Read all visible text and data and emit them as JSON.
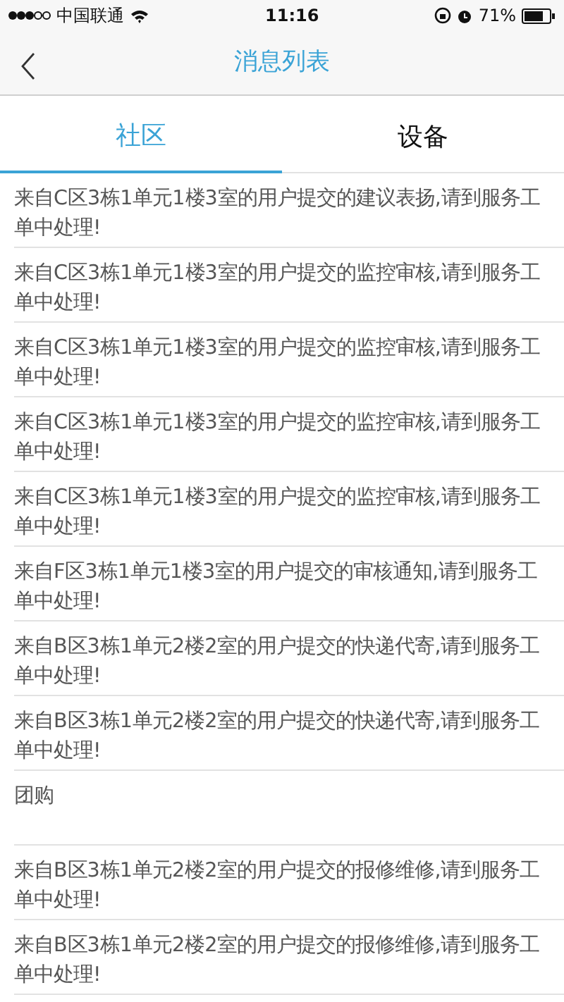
{
  "status_bar": {
    "carrier": "中国联通",
    "time": "11:16",
    "battery": "71%"
  },
  "nav": {
    "title": "消息列表"
  },
  "tabs": [
    {
      "label": "社区",
      "selected": true
    },
    {
      "label": "设备",
      "selected": false
    }
  ],
  "messages": [
    {
      "lines": [
        "来自C区3栋1单元1楼3室的用户提交的建议表扬,请到服务工",
        "单中处理!"
      ]
    },
    {
      "lines": [
        "来自C区3栋1单元1楼3室的用户提交的监控审核,请到服务工",
        "单中处理!"
      ]
    },
    {
      "lines": [
        "来自C区3栋1单元1楼3室的用户提交的监控审核,请到服务工",
        "单中处理!"
      ]
    },
    {
      "lines": [
        "来自C区3栋1单元1楼3室的用户提交的监控审核,请到服务工",
        "单中处理!"
      ]
    },
    {
      "lines": [
        "来自C区3栋1单元1楼3室的用户提交的监控审核,请到服务工",
        "单中处理!"
      ]
    },
    {
      "lines": [
        "来自F区3栋1单元1楼3室的用户提交的审核通知,请到服务工",
        "单中处理!"
      ]
    },
    {
      "lines": [
        "来自B区3栋1单元2楼2室的用户提交的快递代寄,请到服务工",
        "单中处理!"
      ]
    },
    {
      "lines": [
        "来自B区3栋1单元2楼2室的用户提交的快递代寄,请到服务工",
        "单中处理!"
      ]
    },
    {
      "lines": [
        "团购"
      ]
    },
    {
      "lines": [
        "来自B区3栋1单元2楼2室的用户提交的报修维修,请到服务工",
        "单中处理!"
      ]
    },
    {
      "lines": [
        "来自B区3栋1单元2楼2室的用户提交的报修维修,请到服务工",
        "单中处理!"
      ]
    }
  ]
}
